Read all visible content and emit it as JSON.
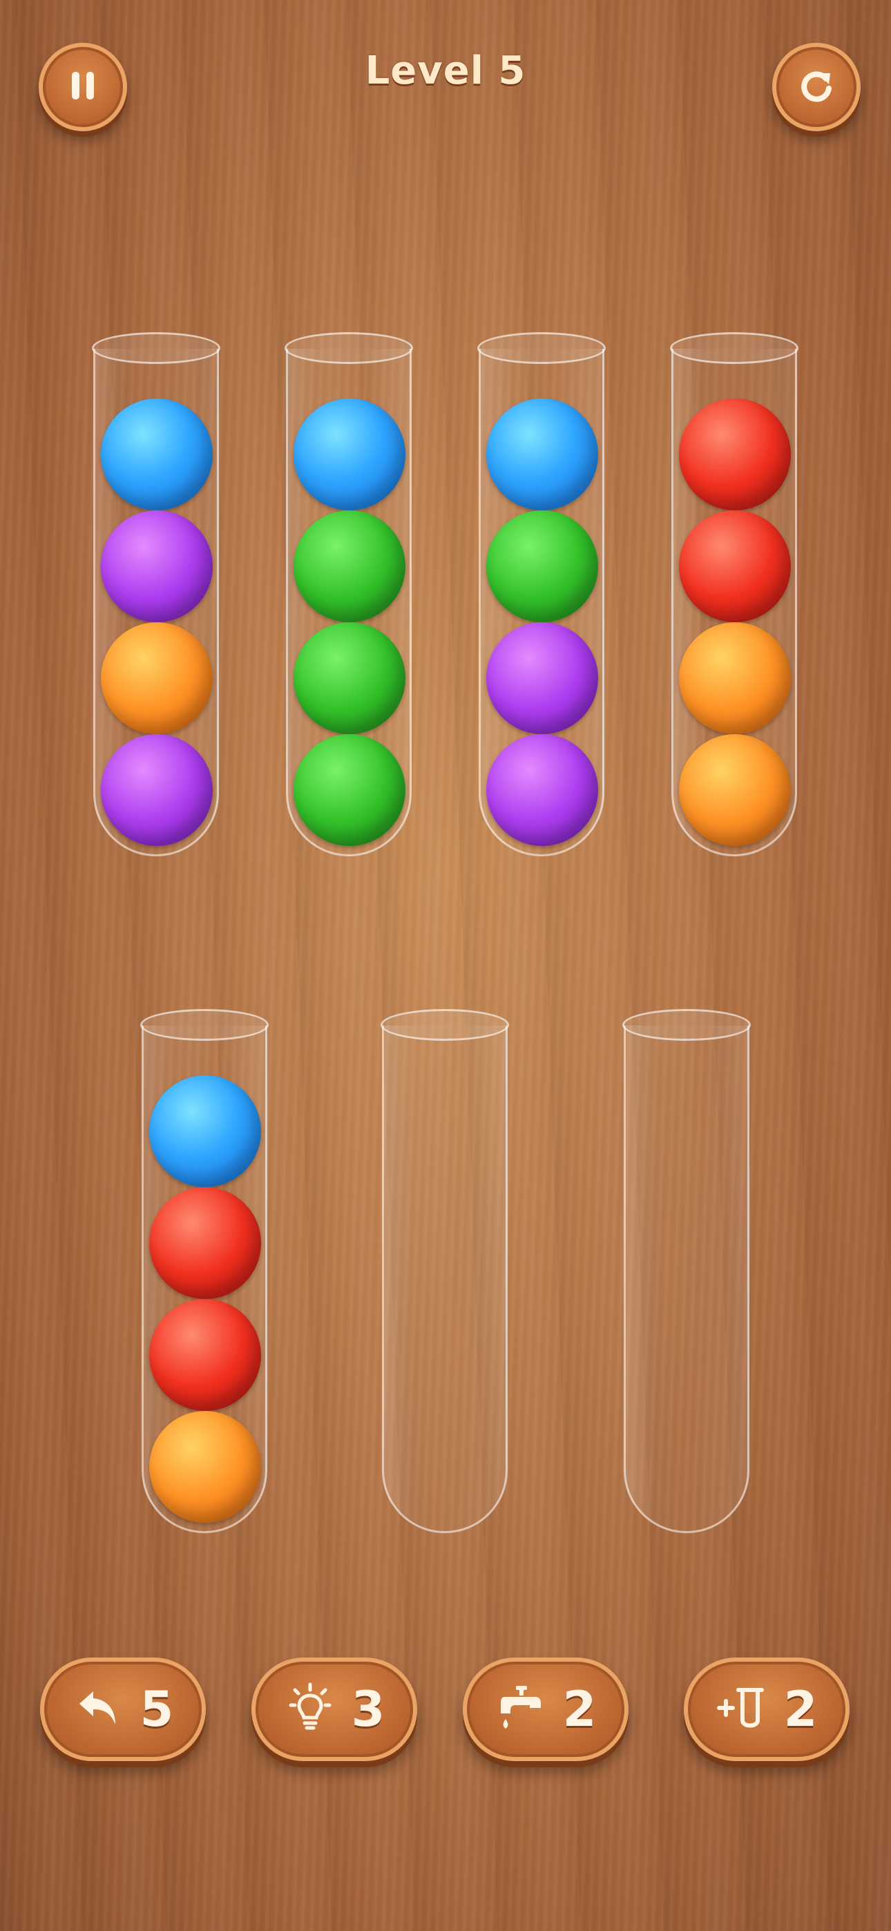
{
  "header": {
    "level_title": "Level 5",
    "pause_icon": "pause-icon",
    "restart_icon": "restart-icon"
  },
  "colors": {
    "blue": "#2fa6ff",
    "purple": "#ae3ef0",
    "orange": "#ff9326",
    "green": "#33c22a",
    "red": "#f2301f",
    "button": "#b8622d"
  },
  "tubes": [
    {
      "balls": [
        "blue",
        "purple",
        "orange",
        "purple"
      ]
    },
    {
      "balls": [
        "blue",
        "green",
        "green",
        "green"
      ]
    },
    {
      "balls": [
        "blue",
        "green",
        "purple",
        "purple"
      ]
    },
    {
      "balls": [
        "red",
        "red",
        "orange",
        "orange"
      ]
    },
    {
      "balls": [
        "blue",
        "red",
        "red",
        "orange"
      ]
    },
    {
      "balls": []
    },
    {
      "balls": []
    }
  ],
  "powerups": [
    {
      "name": "undo",
      "icon": "undo-icon",
      "count": "5"
    },
    {
      "name": "hint",
      "icon": "lightbulb-icon",
      "count": "3"
    },
    {
      "name": "pour",
      "icon": "faucet-icon",
      "count": "2"
    },
    {
      "name": "add-tube",
      "icon": "add-tube-icon",
      "count": "2"
    }
  ]
}
